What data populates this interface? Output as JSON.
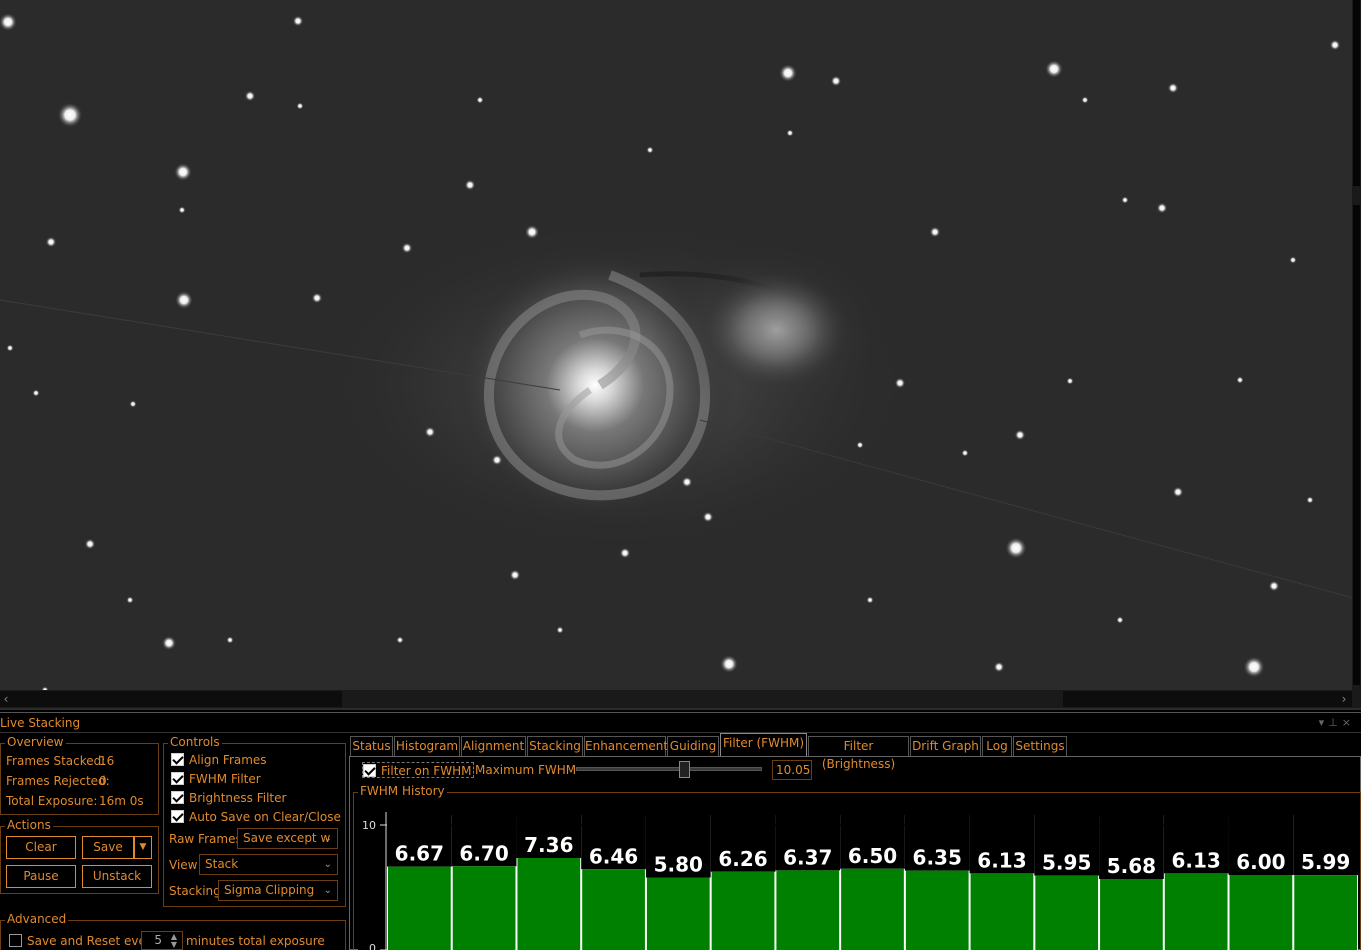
{
  "panel": {
    "title": "Live Stacking"
  },
  "overview": {
    "legend": "Overview",
    "frames_stacked_label": "Frames Stacked:",
    "frames_stacked_value": "16",
    "frames_rejected_label": "Frames Rejected:",
    "frames_rejected_value": "0",
    "total_exposure_label": "Total Exposure:",
    "total_exposure_value": "16m 0s"
  },
  "actions": {
    "legend": "Actions",
    "clear": "Clear",
    "save": "Save",
    "pause": "Pause",
    "unstack": "Unstack"
  },
  "controls": {
    "legend": "Controls",
    "align_frames": "Align Frames",
    "fwhm_filter": "FWHM Filter",
    "brightness_filter": "Brightness Filter",
    "auto_save": "Auto Save on Clear/Close",
    "raw_frames_label": "Raw Frames",
    "raw_frames_value": "Save except w",
    "view_label": "View",
    "view_value": "Stack",
    "stacking_label": "Stacking",
    "stacking_value": "Sigma Clipping"
  },
  "advanced": {
    "legend": "Advanced",
    "save_reset_label": "Save and Reset every",
    "save_reset_value": "5",
    "minutes_label": "minutes total exposure"
  },
  "tabs": [
    "Status",
    "Histogram",
    "Alignment",
    "Stacking",
    "Enhancement",
    "Guiding",
    "Filter (FWHM)",
    "Filter (Brightness)",
    "Drift Graph",
    "Log",
    "Settings"
  ],
  "active_tab": "Filter (FWHM)",
  "fwhm_filter": {
    "filter_on_label": "Filter on FWHM",
    "max_label": "Maximum FWHM",
    "max_value": "10.05",
    "max_slider_fraction": 0.58,
    "history_legend": "FWHM History"
  },
  "colors": {
    "accent": "#e08a2e",
    "bar": "#008000",
    "threshold": "#3a3aff"
  },
  "chart_data": {
    "type": "bar",
    "title": "FWHM History",
    "values": [
      6.67,
      6.7,
      7.36,
      6.46,
      5.8,
      6.26,
      6.37,
      6.5,
      6.35,
      6.13,
      5.95,
      5.68,
      6.13,
      6.0,
      5.99
    ],
    "labels": [
      "6.67",
      "6.70",
      "7.36",
      "6.46",
      "5.80",
      "6.26",
      "6.37",
      "6.50",
      "6.35",
      "6.13",
      "5.95",
      "5.68",
      "6.13",
      "6.00",
      "5.99"
    ],
    "threshold": 10,
    "y_ticks": [
      "10",
      "0"
    ],
    "ylim": [
      0,
      10.8
    ]
  }
}
